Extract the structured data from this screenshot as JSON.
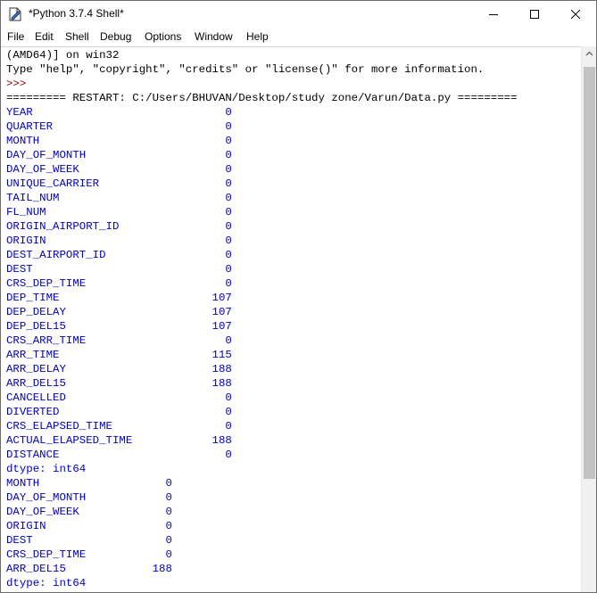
{
  "window": {
    "title": "*Python 3.7.4 Shell*",
    "controls": [
      "minimize",
      "maximize",
      "close"
    ]
  },
  "menu": [
    "File",
    "Edit",
    "Shell",
    "Debug",
    "Options",
    "Window",
    "Help"
  ],
  "header": {
    "line1": "(AMD64)] on win32",
    "line2": "Type \"help\", \"copyright\", \"credits\" or \"license()\" for more information.",
    "prompt": ">>>",
    "restart": "========= RESTART: C:/Users/BHUVAN/Desktop/study zone/Varun/Data.py ========="
  },
  "series1": [
    {
      "name": "YEAR",
      "value": "0"
    },
    {
      "name": "QUARTER",
      "value": "0"
    },
    {
      "name": "MONTH",
      "value": "0"
    },
    {
      "name": "DAY_OF_MONTH",
      "value": "0"
    },
    {
      "name": "DAY_OF_WEEK",
      "value": "0"
    },
    {
      "name": "UNIQUE_CARRIER",
      "value": "0"
    },
    {
      "name": "TAIL_NUM",
      "value": "0"
    },
    {
      "name": "FL_NUM",
      "value": "0"
    },
    {
      "name": "ORIGIN_AIRPORT_ID",
      "value": "0"
    },
    {
      "name": "ORIGIN",
      "value": "0"
    },
    {
      "name": "DEST_AIRPORT_ID",
      "value": "0"
    },
    {
      "name": "DEST",
      "value": "0"
    },
    {
      "name": "CRS_DEP_TIME",
      "value": "0"
    },
    {
      "name": "DEP_TIME",
      "value": "107"
    },
    {
      "name": "DEP_DELAY",
      "value": "107"
    },
    {
      "name": "DEP_DEL15",
      "value": "107"
    },
    {
      "name": "CRS_ARR_TIME",
      "value": "0"
    },
    {
      "name": "ARR_TIME",
      "value": "115"
    },
    {
      "name": "ARR_DELAY",
      "value": "188"
    },
    {
      "name": "ARR_DEL15",
      "value": "188"
    },
    {
      "name": "CANCELLED",
      "value": "0"
    },
    {
      "name": "DIVERTED",
      "value": "0"
    },
    {
      "name": "CRS_ELAPSED_TIME",
      "value": "0"
    },
    {
      "name": "ACTUAL_ELAPSED_TIME",
      "value": "188"
    },
    {
      "name": "DISTANCE",
      "value": "0"
    }
  ],
  "dtype1": "dtype: int64",
  "series2": [
    {
      "name": "MONTH",
      "value": "0"
    },
    {
      "name": "DAY_OF_MONTH",
      "value": "0"
    },
    {
      "name": "DAY_OF_WEEK",
      "value": "0"
    },
    {
      "name": "ORIGIN",
      "value": "0"
    },
    {
      "name": "DEST",
      "value": "0"
    },
    {
      "name": "CRS_DEP_TIME",
      "value": "0"
    },
    {
      "name": "ARR_DEL15",
      "value": "188"
    }
  ],
  "dtype2": "dtype: int64",
  "colors": {
    "output_text": "#0000c8",
    "prompt": "#8b0000",
    "scroll_thumb": "#c2c2c2"
  }
}
